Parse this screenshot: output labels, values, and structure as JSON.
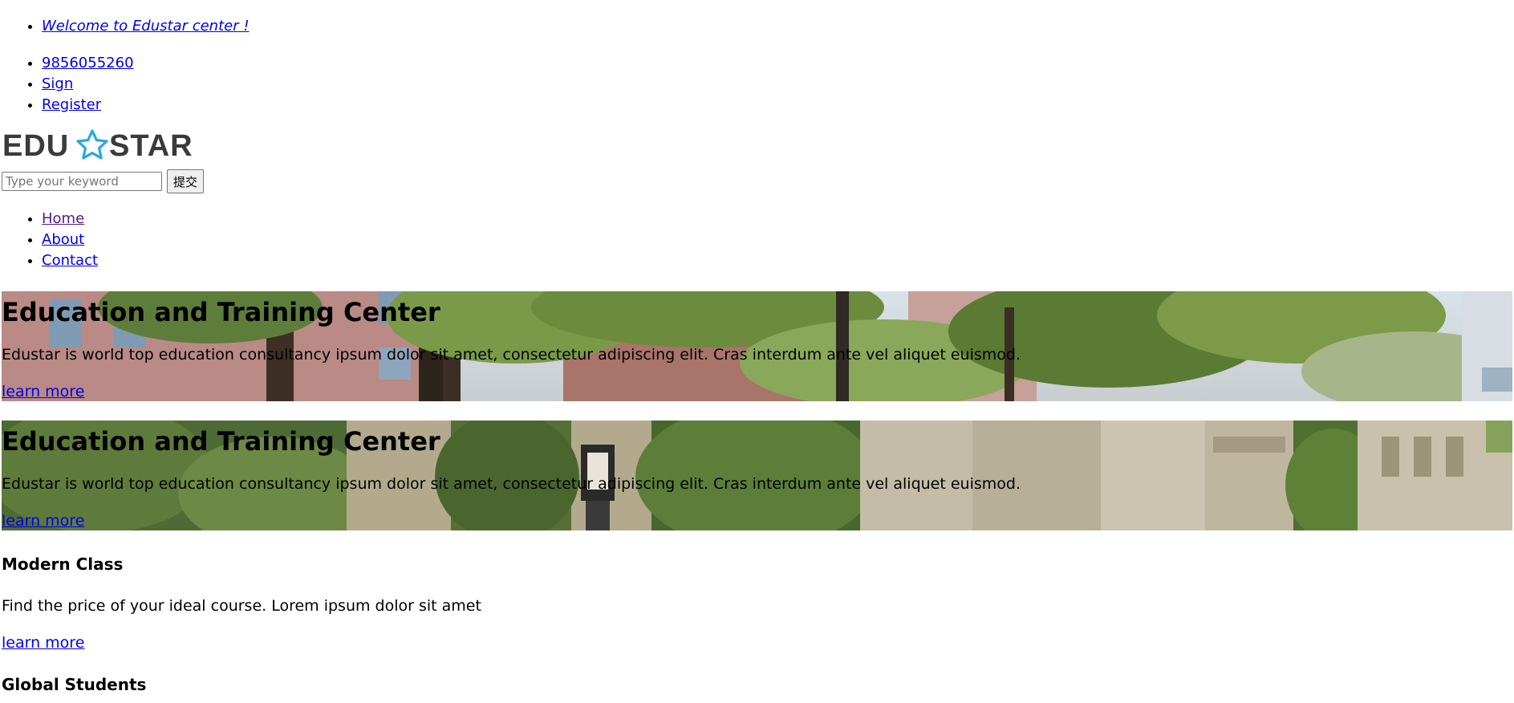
{
  "topbar": {
    "welcome": "Welcome to Edustar center !",
    "phone": "9856055260",
    "sign": "Sign",
    "register": "Register"
  },
  "logo": {
    "left": "EDU",
    "right": "STAR",
    "star_color": "#29a8e0",
    "text_color": "#3a3a3a"
  },
  "search": {
    "placeholder": "Type your keyword",
    "value": "",
    "submit_label": "提交"
  },
  "nav": {
    "items": [
      "Home",
      "About",
      "Contact"
    ]
  },
  "slides": [
    {
      "title": "Education and Training Center",
      "text": "Edustar is world top education consultancy ipsum dolor sit amet, consectetur adipiscing elit. Cras interdum ante vel aliquet euismod.",
      "link": "learn more"
    },
    {
      "title": "Education and Training Center",
      "text": "Edustar is world top education consultancy ipsum dolor sit amet, consectetur adipiscing elit. Cras interdum ante vel aliquet euismod.",
      "link": "learn more"
    }
  ],
  "features": [
    {
      "title": "Modern Class",
      "text": "Find the price of your ideal course. Lorem ipsum dolor sit amet",
      "link": "learn more"
    },
    {
      "title": "Global Students"
    }
  ]
}
